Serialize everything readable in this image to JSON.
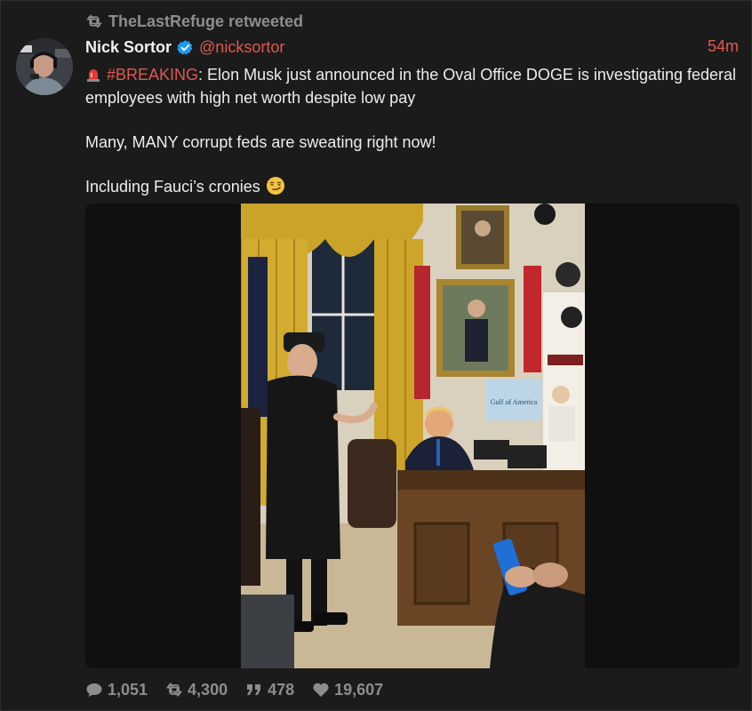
{
  "retweet": {
    "icon": "retweet-icon",
    "text": "TheLastRefuge retweeted"
  },
  "author": {
    "display_name": "Nick Sortor",
    "verified_icon": "verified-badge-icon",
    "handle": "@nicksortor",
    "time": "54m"
  },
  "tweet": {
    "breaking_emoji": "rotating-light-icon",
    "hashtag": "#BREAKING",
    "line1_rest": ": Elon Musk just announced in the Oval Office DOGE is investigating federal employees with high net worth despite low pay",
    "line2": "Many, MANY corrupt feds are sweating right now!",
    "line3": "Including Fauci’s cronies",
    "smirk_emoji": "smirking-face-icon"
  },
  "media": {
    "sign_text": "Gulf of America"
  },
  "stats": {
    "replies": "1,051",
    "retweets": "4,300",
    "quotes": "478",
    "likes": "19,607"
  },
  "colors": {
    "accent": "#e0584f",
    "muted": "#8d8d8d",
    "background": "#1b1b1b",
    "verified": "#1d9bf0"
  }
}
